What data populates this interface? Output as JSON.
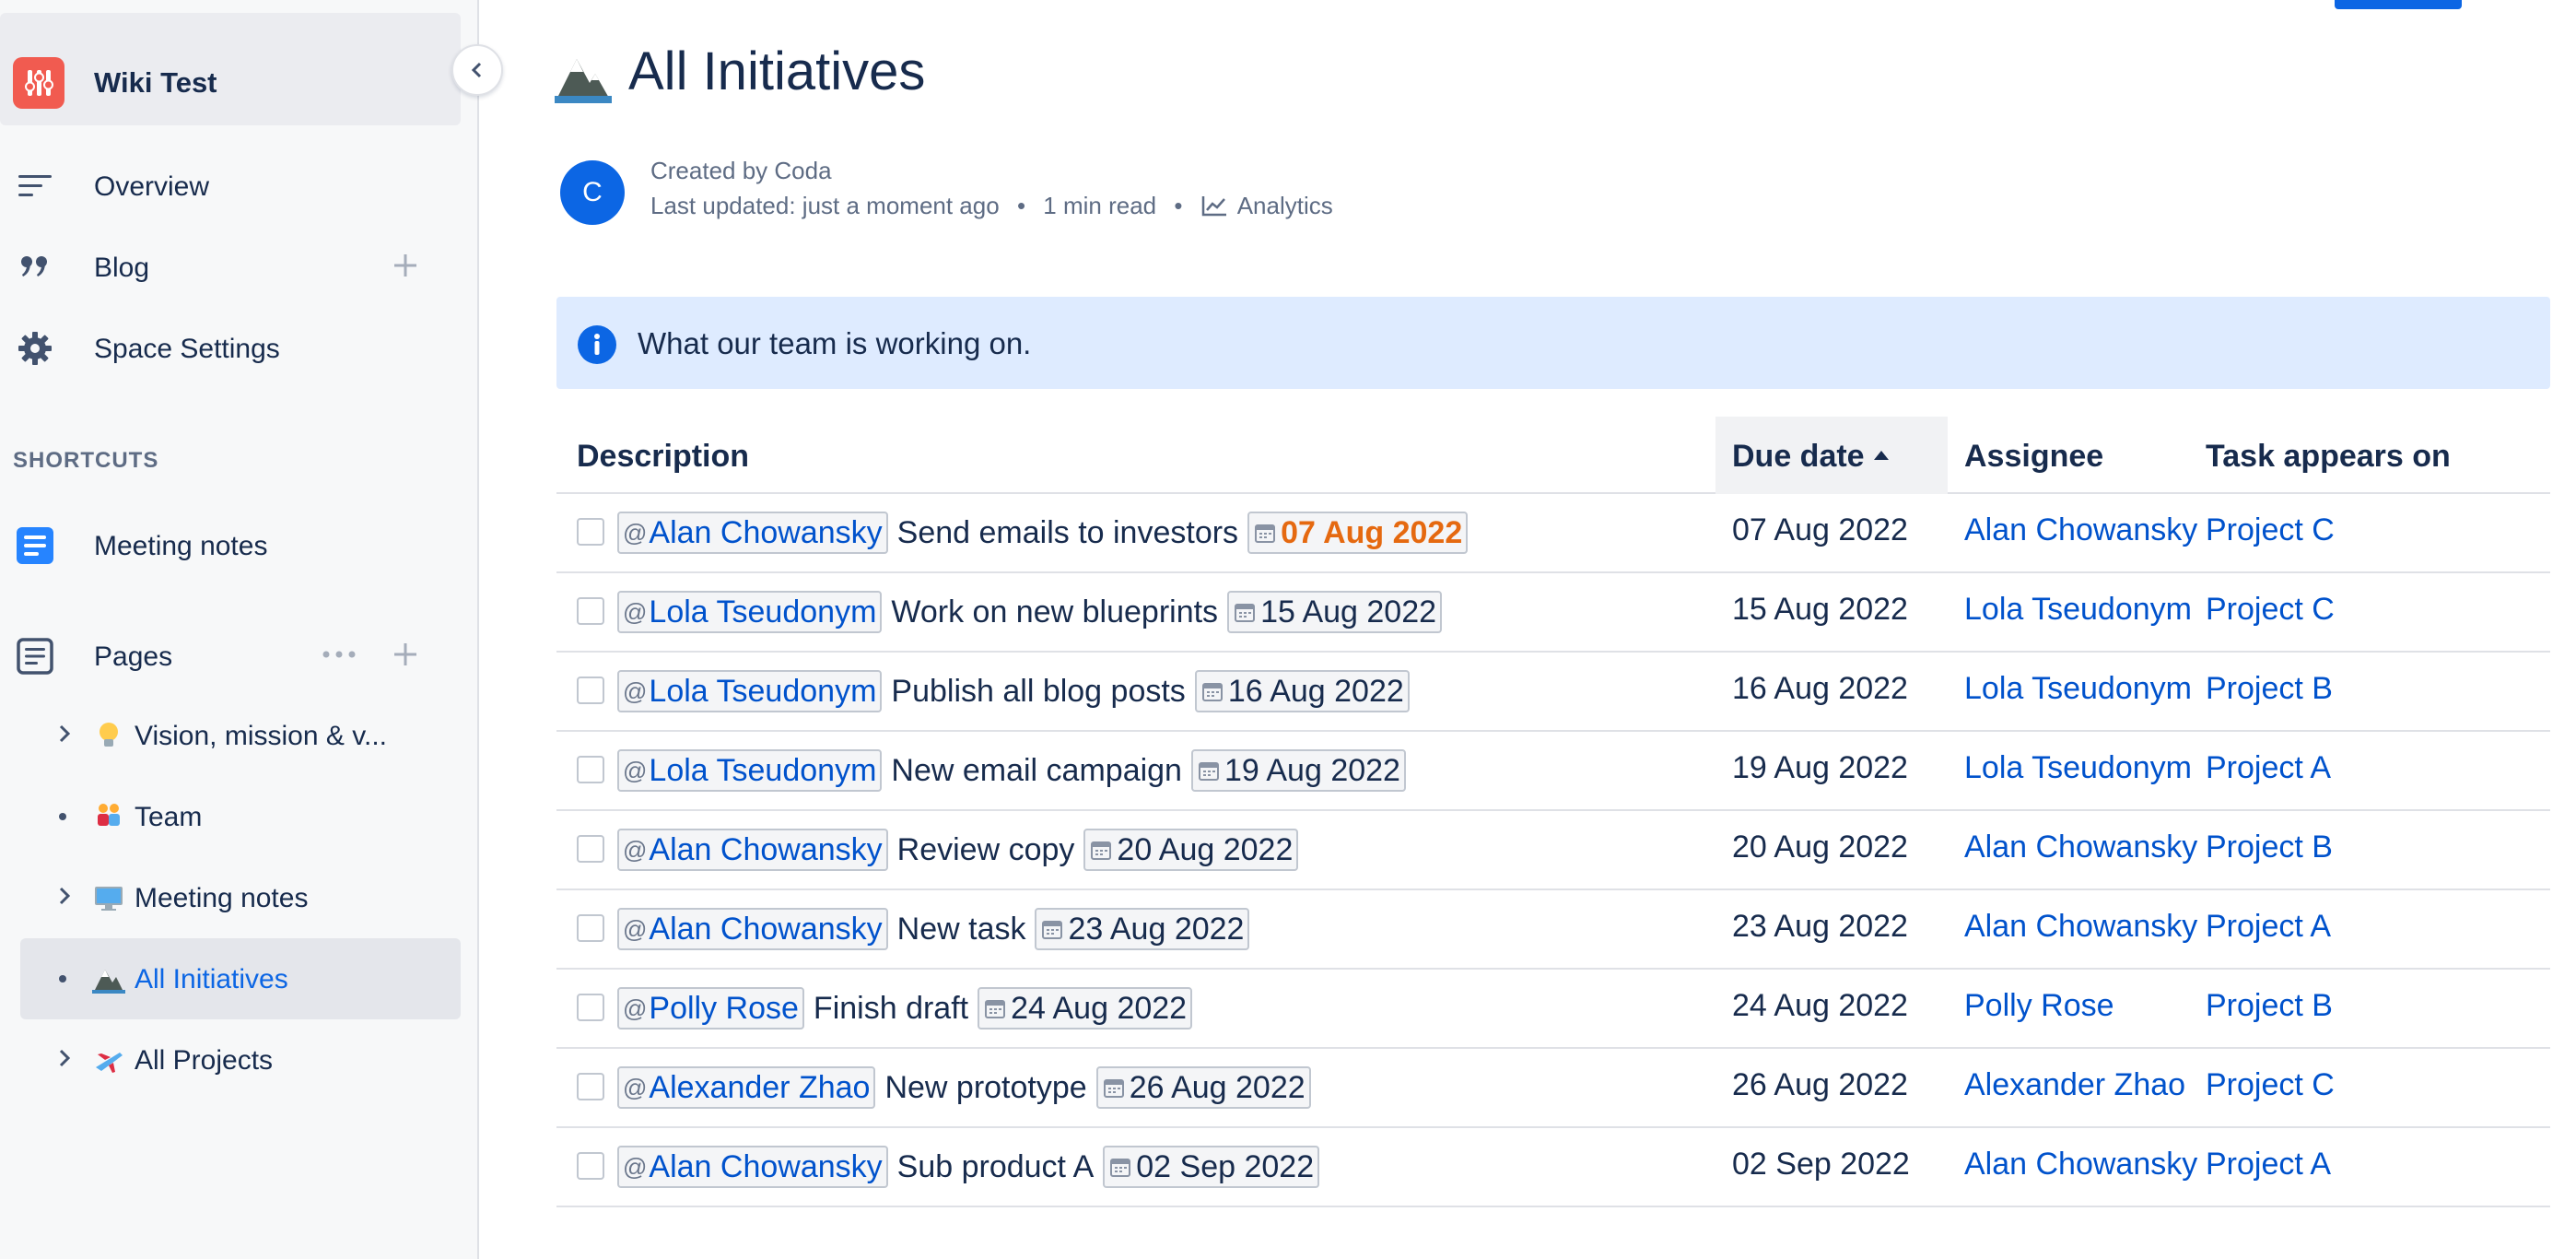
{
  "sidebar": {
    "space_title": "Wiki Test",
    "nav": {
      "overview": "Overview",
      "blog": "Blog",
      "space_settings": "Space Settings"
    },
    "shortcuts_heading": "SHORTCUTS",
    "shortcut_meeting_notes": "Meeting notes",
    "pages_label": "Pages",
    "tree": [
      {
        "label": "Vision, mission & v...",
        "icon": "lightbulb-icon",
        "expandable": true
      },
      {
        "label": "Team",
        "icon": "people-icon",
        "expandable": false
      },
      {
        "label": "Meeting notes",
        "icon": "computer-icon",
        "expandable": true
      },
      {
        "label": "All Initiatives",
        "icon": "mountain-icon",
        "expandable": false,
        "active": true
      },
      {
        "label": "All Projects",
        "icon": "airplane-icon",
        "expandable": true
      }
    ]
  },
  "page": {
    "title": "All Initiatives",
    "avatar_letter": "C",
    "created_by": "Created by Coda",
    "last_updated": "Last updated: just a moment ago",
    "read_time": "1 min read",
    "analytics": "Analytics",
    "separator": "•",
    "info_text": "What our team is working on."
  },
  "table": {
    "headers": {
      "description": "Description",
      "due_date": "Due date",
      "assignee": "Assignee",
      "task_appears_on": "Task appears on"
    },
    "rows": [
      {
        "mention": "Alan Chowansky",
        "task": "Send emails to investors",
        "chip_date": "07 Aug 2022",
        "overdue": true,
        "due": "07 Aug 2022",
        "assignee": "Alan Chowansky",
        "page": "Project C"
      },
      {
        "mention": "Lola Tseudonym",
        "task": "Work on new blueprints",
        "chip_date": "15 Aug 2022",
        "overdue": false,
        "due": "15 Aug 2022",
        "assignee": "Lola Tseudonym",
        "page": "Project C"
      },
      {
        "mention": "Lola Tseudonym",
        "task": "Publish all blog posts",
        "chip_date": "16 Aug 2022",
        "overdue": false,
        "due": "16 Aug 2022",
        "assignee": "Lola Tseudonym",
        "page": "Project B"
      },
      {
        "mention": "Lola Tseudonym",
        "task": "New email campaign",
        "chip_date": "19 Aug 2022",
        "overdue": false,
        "due": "19 Aug 2022",
        "assignee": "Lola Tseudonym",
        "page": "Project A"
      },
      {
        "mention": "Alan Chowansky",
        "task": "Review copy",
        "chip_date": "20 Aug 2022",
        "overdue": false,
        "due": "20 Aug 2022",
        "assignee": "Alan Chowansky",
        "page": "Project B"
      },
      {
        "mention": "Alan Chowansky",
        "task": "New task",
        "chip_date": "23 Aug 2022",
        "overdue": false,
        "due": "23 Aug 2022",
        "assignee": "Alan Chowansky",
        "page": "Project A"
      },
      {
        "mention": "Polly Rose",
        "task": "Finish draft",
        "chip_date": "24 Aug 2022",
        "overdue": false,
        "due": "24 Aug 2022",
        "assignee": "Polly Rose",
        "page": "Project B"
      },
      {
        "mention": "Alexander Zhao",
        "task": "New prototype",
        "chip_date": "26 Aug 2022",
        "overdue": false,
        "due": "26 Aug 2022",
        "assignee": "Alexander Zhao",
        "page": "Project C"
      },
      {
        "mention": "Alan Chowansky",
        "task": "Sub product A",
        "chip_date": "02 Sep 2022",
        "overdue": false,
        "due": "02 Sep 2022",
        "assignee": "Alan Chowansky",
        "page": "Project A"
      }
    ]
  },
  "colors": {
    "link": "#0052cc",
    "overdue": "#e56910",
    "info_bg": "#deebff",
    "brand": "#f15b50"
  }
}
